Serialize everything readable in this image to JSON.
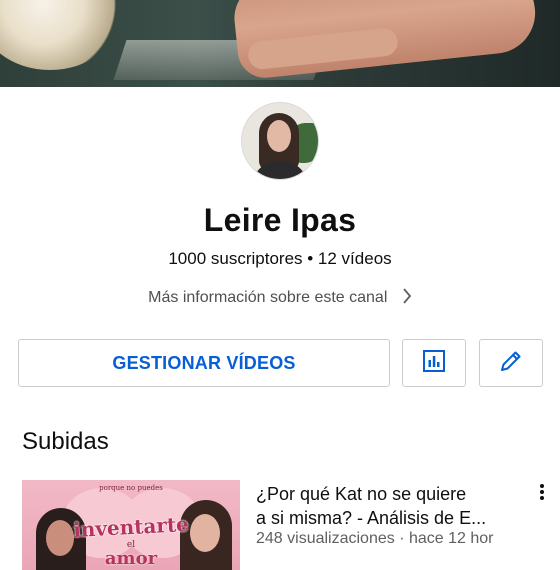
{
  "channel": {
    "name": "Leire Ipas",
    "stats": "1000 suscriptores • 12 vídeos",
    "more_info": "Más información sobre este canal"
  },
  "actions": {
    "manage_videos": "GESTIONAR VÍDEOS",
    "analytics_icon": "bar-chart-icon",
    "edit_icon": "pencil-icon"
  },
  "uploads": {
    "section_title": "Subidas",
    "videos": [
      {
        "title_line1": "¿Por qué Kat no se quiere",
        "title_line2": "a si misma? - Análisis de E...",
        "meta": "248 visualizaciones · hace 12 hor",
        "thumbnail_text": {
          "small": "porque no puedes",
          "big": "inventarte",
          "mid": "el",
          "big2": "amor"
        }
      }
    ]
  },
  "colors": {
    "accent": "#065fd4",
    "text_primary": "#0f0f0f",
    "text_secondary": "#606060",
    "border": "#cccccc"
  }
}
